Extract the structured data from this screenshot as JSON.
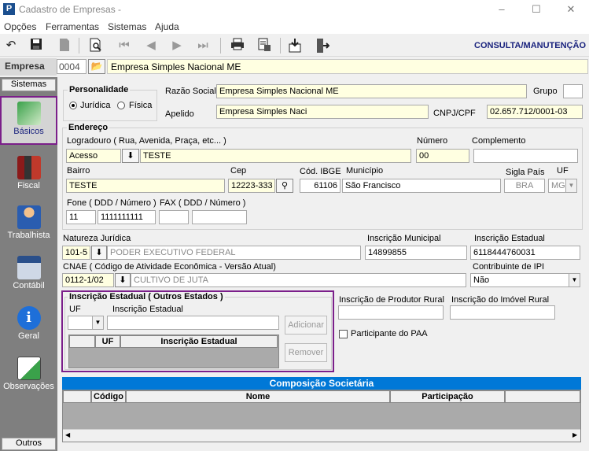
{
  "window": {
    "title": "Cadastro de Empresas -",
    "app_icon": "P",
    "minimize": "–",
    "maximize": "☐",
    "close": "✕"
  },
  "menu": [
    "Opções",
    "Ferramentas",
    "Sistemas",
    "Ajuda"
  ],
  "toolbar": {
    "mode_label": "CONSULTA/MANUTENÇÃO"
  },
  "empresa": {
    "label": "Empresa",
    "code": "0004",
    "name": "Empresa Simples Nacional ME"
  },
  "sidebar": {
    "top_label": "Sistemas",
    "bottom_label": "Outros",
    "items": [
      {
        "label": "Básicos",
        "icon": "folder-icon"
      },
      {
        "label": "Fiscal",
        "icon": "books-icon"
      },
      {
        "label": "Trabalhista",
        "icon": "worker-icon"
      },
      {
        "label": "Contábil",
        "icon": "calculator-icon"
      },
      {
        "label": "Geral",
        "icon": "info-icon"
      },
      {
        "label": "Observações",
        "icon": "notepad-icon"
      }
    ]
  },
  "personalidade": {
    "title": "Personalidade",
    "juridica": "Jurídica",
    "fisica": "Física",
    "selected": "Jurídica"
  },
  "identificacao": {
    "razao_social_label": "Razão Social",
    "razao_social": "Empresa Simples Nacional ME",
    "grupo_label": "Grupo",
    "grupo": "",
    "apelido_label": "Apelido",
    "apelido": "Empresa Simples Naci",
    "cnpj_label": "CNPJ/CPF",
    "cnpj": "02.657.712/0001-03"
  },
  "endereco": {
    "title": "Endereço",
    "logradouro_label": "Logradouro ( Rua, Avenida, Praça, etc... )",
    "logradouro_tipo": "Acesso",
    "logradouro": "TESTE",
    "numero_label": "Número",
    "numero": "00",
    "complemento_label": "Complemento",
    "complemento": "",
    "bairro_label": "Bairro",
    "bairro": "TESTE",
    "cep_label": "Cep",
    "cep": "12223-333",
    "ibge_label": "Cód. IBGE",
    "ibge": "61106",
    "municipio_label": "Município",
    "municipio": "São Francisco",
    "sigla_pais_label": "Sigla País",
    "sigla_pais": "BRA",
    "uf_label": "UF",
    "uf": "MG",
    "fone_label": "Fone ( DDD / Número )",
    "fone_ddd": "11",
    "fone_numero": "1111111111",
    "fax_label": "FAX ( DDD / Número )",
    "fax_ddd": "",
    "fax_numero": ""
  },
  "fiscal": {
    "natureza_label": "Natureza Jurídica",
    "natureza_code": "101-5",
    "natureza_desc": "PODER EXECUTIVO FEDERAL",
    "insc_municipal_label": "Inscrição Municipal",
    "insc_municipal": "14899855",
    "insc_estadual_label": "Inscrição Estadual",
    "insc_estadual": "6118444760031",
    "cnae_label": "CNAE ( Código de Atividade Econômica - Versão Atual)",
    "cnae_code": "0112-1/02",
    "cnae_desc": "CULTIVO DE JUTA",
    "ipi_label": "Contribuinte de IPI",
    "ipi": "Não"
  },
  "outros_estados": {
    "title": "Inscrição Estadual ( Outros Estados )",
    "uf_label": "UF",
    "insc_label": "Inscrição Estadual",
    "uf_value": "",
    "insc_value": "",
    "add_button": "Adicionar",
    "remove_button": "Remover",
    "columns": [
      "",
      "UF",
      "Inscrição Estadual"
    ]
  },
  "rural": {
    "produtor_label": "Inscrição de Produtor Rural",
    "produtor": "",
    "imovel_label": "Inscrição do Imóvel Rural",
    "imovel": "",
    "paa_label": "Participante do PAA"
  },
  "composicao": {
    "title": "Composição Societária",
    "columns": [
      "",
      "Código",
      "Nome",
      "Participação"
    ]
  }
}
